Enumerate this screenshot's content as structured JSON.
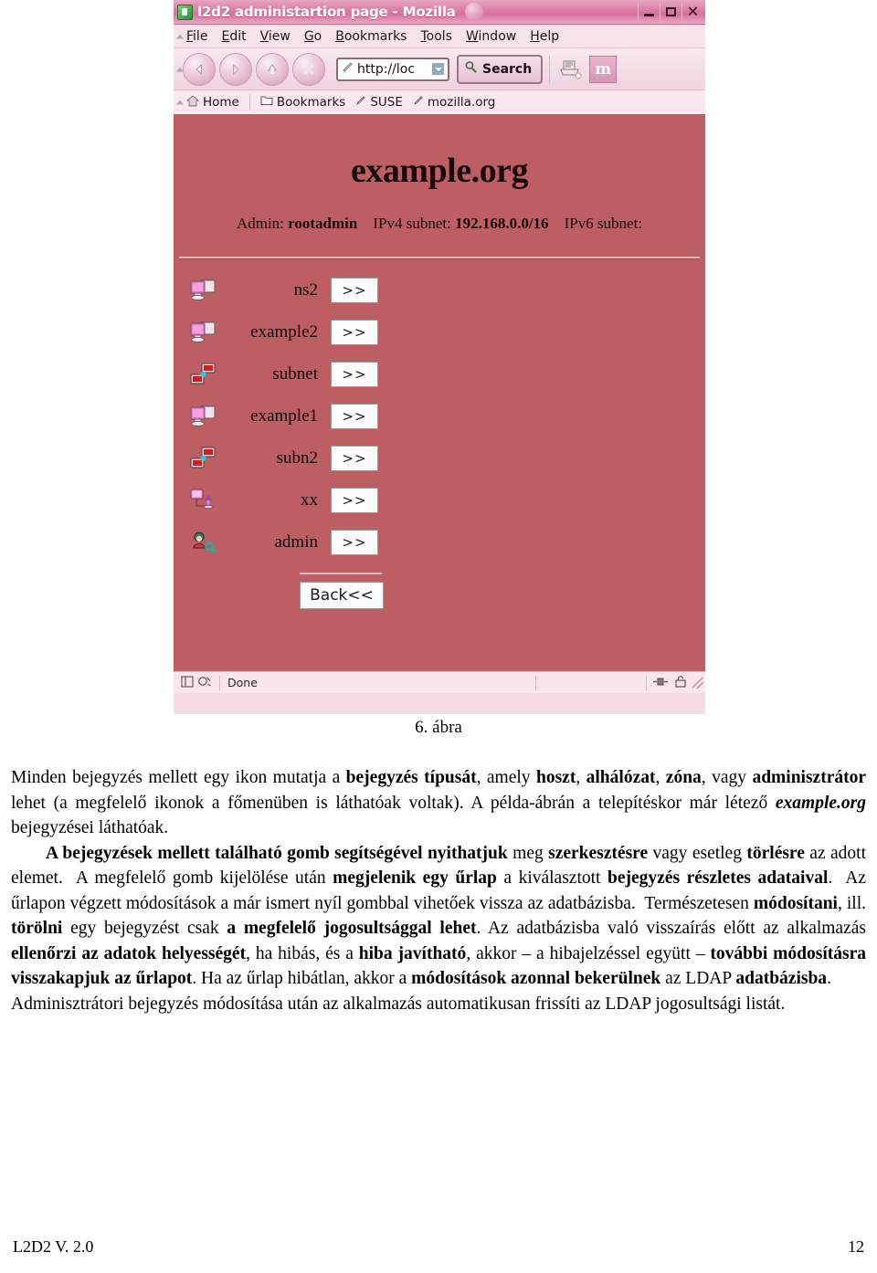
{
  "figure": {
    "browser": {
      "window_title": "l2d2 administartion page - Mozilla",
      "window_controls": {
        "minimize": "_",
        "maximize": "□",
        "close": "X"
      },
      "menus": [
        {
          "accel": "F",
          "rest": "ile"
        },
        {
          "accel": "E",
          "rest": "dit"
        },
        {
          "accel": "V",
          "rest": "iew"
        },
        {
          "accel": "G",
          "rest": "o"
        },
        {
          "accel": "B",
          "rest": "ookmarks"
        },
        {
          "accel": "T",
          "rest": "ools"
        },
        {
          "accel": "W",
          "rest": "indow"
        },
        {
          "accel": "H",
          "rest": "elp"
        }
      ],
      "nav": {
        "back": "back-icon",
        "forward": "forward-icon",
        "reload": "reload-icon",
        "stop": "stop-icon",
        "url_value": "http://loc",
        "url_placeholder": "http://",
        "search_label": "Search",
        "print": "print-icon",
        "mozilla_logo": "m"
      },
      "bookmarks": [
        {
          "label": "Home",
          "icon": "home-icon"
        },
        {
          "label": "Bookmarks",
          "icon": "folder-icon"
        },
        {
          "label": "SUSE",
          "icon": "bookmark-icon"
        },
        {
          "label": "mozilla.org",
          "icon": "bookmark-icon"
        }
      ],
      "statusbar": {
        "status_text": "Done",
        "icons": [
          "sidebar-icon",
          "cookie-icon"
        ],
        "right_icons": [
          "connection-icon",
          "security-lock-icon"
        ]
      }
    },
    "page": {
      "background_color": "#bc5e62",
      "title": "example.org",
      "info": {
        "admin_label": "Admin:",
        "admin_value": "rootadmin",
        "ipv4_label": "IPv4 subnet:",
        "ipv4_value": "192.168.0.0/16",
        "ipv6_label": "IPv6 subnet:",
        "ipv6_value": ""
      },
      "entries": [
        {
          "name": "ns2",
          "type": "host",
          "icon": "host-computer-icon",
          "button": ">>"
        },
        {
          "name": "example2",
          "type": "host",
          "icon": "host-computer-icon",
          "button": ">>"
        },
        {
          "name": "subnet",
          "type": "subnet",
          "icon": "subnet-network-icon",
          "button": ">>"
        },
        {
          "name": "example1",
          "type": "host",
          "icon": "host-computer-icon",
          "button": ">>"
        },
        {
          "name": "subn2",
          "type": "subnet",
          "icon": "subnet-network-icon",
          "button": ">>"
        },
        {
          "name": "xx",
          "type": "zone",
          "icon": "zone-icon",
          "button": ">>"
        },
        {
          "name": "admin",
          "type": "admin",
          "icon": "admin-user-icon",
          "button": ">>"
        }
      ],
      "back_button": "Back<<"
    }
  },
  "caption": "6. ábra",
  "body": {
    "p1_html": "Minden bejegyzés mellett egy ikon mutatja a <b>bejegyzés típusát</b>, amely <b>hoszt</b>, <b>alhálózat</b>, <b>zóna</b>, vagy <b>adminisztrátor</b> lehet (a megfelelő ikonok a főmenüben is láthatóak voltak). A példa-ábrán a telepítéskor már létező <i>example.org</i> bejegyzései láthatóak.",
    "p2_html": "<b>A bejegyzések mellett található gomb segítségével nyithatjuk</b> meg <b>szerkesztésre</b> vagy esetleg <b>törlésre</b> az adott elemet.&nbsp; A megfelelő gomb kijelölése után <b>megjelenik egy űrlap</b> a kiválasztott <b>bejegyzés részletes adataival</b>.&nbsp; Az űrlapon végzett módosítások a már ismert nyíl gombbal vihetőek vissza az adatbázisba.&nbsp; Természetesen <b>módosítani</b>, ill. <b>törölni</b> egy bejegyzést csak <b>a megfelelő jogosultsággal lehet</b>. Az adatbázisba való visszaírás előtt az alkalmazás <b>ellenőrzi az adatok helyességét</b>, ha hibás, és a <b>hiba javítható</b>, akkor – a hibajelzéssel együtt – <b>további módosításra visszakapjuk az űrlapot</b>. Ha az űrlap hibátlan, akkor a <b>módosítások azonnal bekerülnek</b> az LDAP <b>adatbázisba</b>.",
    "p3_html": "Adminisztrátori bejegyzés módosítása után az alkalmazás automatikusan frissíti az LDAP jogosultsági listát."
  },
  "footer": {
    "left": "L2D2 V. 2.0",
    "right": "12"
  }
}
